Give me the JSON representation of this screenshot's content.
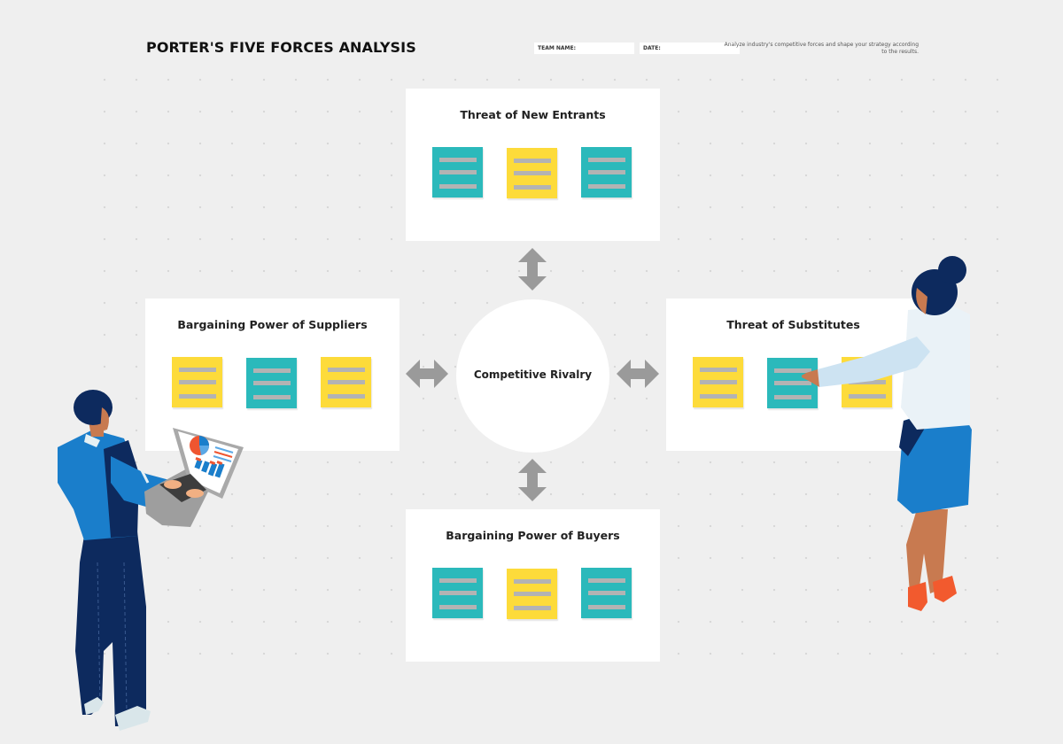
{
  "header": {
    "title": "PORTER'S FIVE FORCES ANALYSIS",
    "team_name_label": "TEAM NAME:",
    "team_name_value": "",
    "date_label": "DATE:",
    "date_value": "",
    "description": "Analyze industry's competitive forces and shape your strategy according to the results."
  },
  "colors": {
    "background": "#efefef",
    "teal_note": "#2bb9bb",
    "yellow_note": "#fddb3a",
    "note_line": "#b3b3b3",
    "arrow": "#9a9a9a"
  },
  "forces": {
    "top": {
      "title": "Threat of New Entrants",
      "notes": [
        "teal",
        "yellow",
        "teal"
      ]
    },
    "left": {
      "title": "Bargaining Power of Suppliers",
      "notes": [
        "yellow",
        "teal",
        "yellow"
      ]
    },
    "right": {
      "title": "Threat of Substitutes",
      "notes": [
        "yellow",
        "teal",
        "yellow"
      ]
    },
    "bottom": {
      "title": "Bargaining Power of Buyers",
      "notes": [
        "teal",
        "yellow",
        "teal"
      ]
    }
  },
  "center": {
    "title": "Competitive Rivalry"
  },
  "illustrations": {
    "left": "man-with-laptop",
    "right": "woman-pointing"
  }
}
